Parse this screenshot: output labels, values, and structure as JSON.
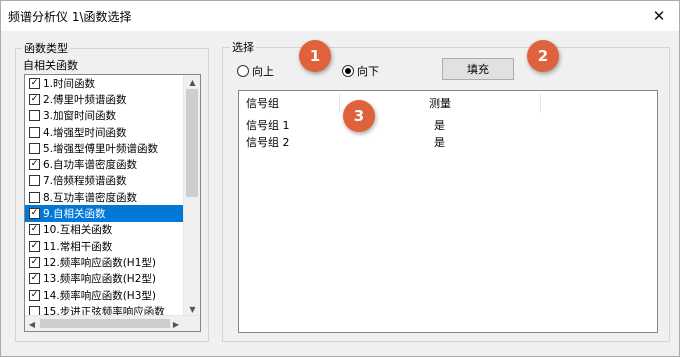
{
  "window": {
    "title": "频谱分析仪 1\\函数选择",
    "close_glyph": "✕"
  },
  "function_group": {
    "label": "函数类型",
    "dropdown_value": "自相关函数",
    "items": [
      {
        "label": "1.时间函数",
        "checked": true,
        "selected": false
      },
      {
        "label": "2.傅里叶频谱函数",
        "checked": true,
        "selected": false
      },
      {
        "label": "3.加窗时间函数",
        "checked": false,
        "selected": false
      },
      {
        "label": "4.增强型时间函数",
        "checked": false,
        "selected": false
      },
      {
        "label": "5.增强型傅里叶频谱函数",
        "checked": false,
        "selected": false
      },
      {
        "label": "6.自功率谱密度函数",
        "checked": true,
        "selected": false
      },
      {
        "label": "7.倍频程频谱函数",
        "checked": false,
        "selected": false
      },
      {
        "label": "8.互功率谱密度函数",
        "checked": false,
        "selected": false
      },
      {
        "label": "9.自相关函数",
        "checked": true,
        "selected": true
      },
      {
        "label": "10.互相关函数",
        "checked": true,
        "selected": false
      },
      {
        "label": "11.常相干函数",
        "checked": true,
        "selected": false
      },
      {
        "label": "12.频率响应函数(H1型)",
        "checked": true,
        "selected": false
      },
      {
        "label": "13.频率响应函数(H2型)",
        "checked": true,
        "selected": false
      },
      {
        "label": "14.频率响应函数(H3型)",
        "checked": true,
        "selected": false
      },
      {
        "label": "15.步进正弦频率响应函数",
        "checked": false,
        "selected": false
      }
    ],
    "scroll_up": "▲",
    "scroll_down": "▼",
    "scroll_left": "◀",
    "scroll_right": "▶"
  },
  "selection_group": {
    "label": "选择",
    "radio_up": {
      "label": "向上",
      "checked": false
    },
    "radio_down": {
      "label": "向下",
      "checked": true
    },
    "fill_button": "填充",
    "table": {
      "headers": [
        "信号组",
        "测量"
      ],
      "rows": [
        {
          "group": "信号组 1",
          "measure": "是"
        },
        {
          "group": "信号组 2",
          "measure": "是"
        }
      ]
    }
  },
  "annotations": [
    {
      "number": "1"
    },
    {
      "number": "2"
    },
    {
      "number": "3"
    }
  ],
  "colors": {
    "selection_highlight": "#0078d7",
    "badge": "#e0623c",
    "window_bg": "#f0f0f0"
  }
}
